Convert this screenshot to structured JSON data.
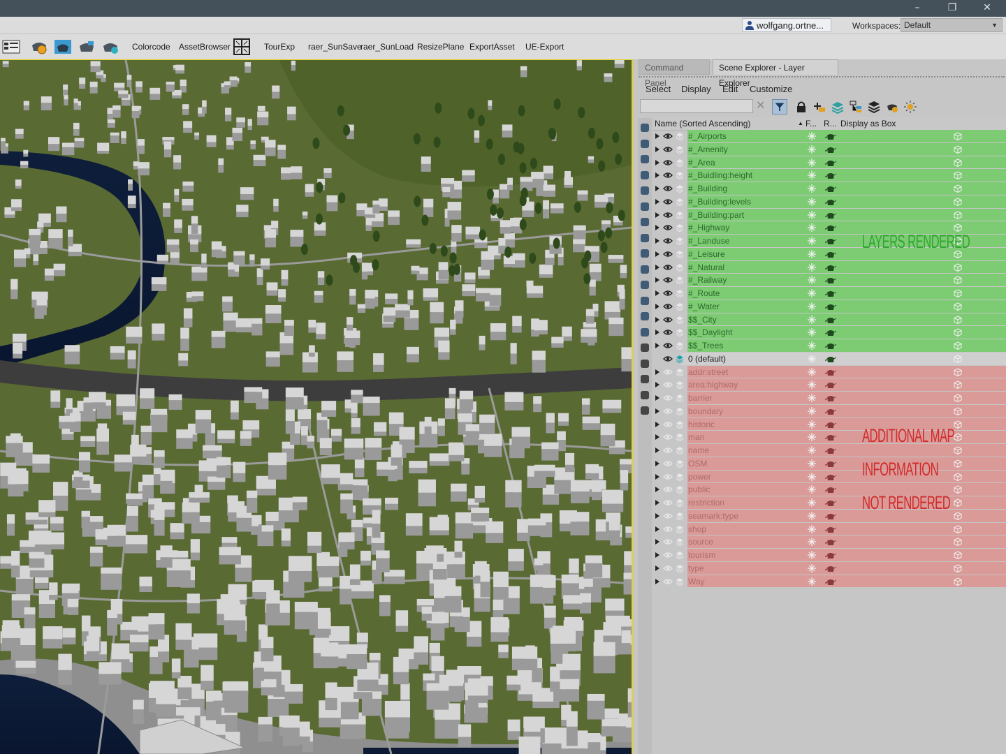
{
  "window": {
    "minimize": "–",
    "maximize": "❐",
    "close": "✕"
  },
  "user": {
    "name": "wolfgang.ortne...",
    "arrow": "▾"
  },
  "workspaces": {
    "label": "Workspaces:",
    "value": "Default"
  },
  "toolbar": {
    "items": [
      "Colorcode",
      "AssetBrowser",
      "TourExp",
      "raer_SunSave",
      "raer_SunLoad",
      "ResizePlane",
      "ExportAsset",
      "UE-Export"
    ]
  },
  "tabs": {
    "command_panel": "Command Panel",
    "scene_explorer": "Scene Explorer - Layer Explorer"
  },
  "scene_menu": {
    "select": "Select",
    "display": "Display",
    "edit": "Edit",
    "customize": "Customize"
  },
  "search": {
    "value": "",
    "clear": "✕"
  },
  "columns": {
    "name": "Name (Sorted Ascending)",
    "sort": "▲",
    "f": "F...",
    "r": "R...",
    "display": "Display as Box"
  },
  "layers": [
    {
      "name": "#_Airports",
      "state": "rendered"
    },
    {
      "name": "#_Amenity",
      "state": "rendered"
    },
    {
      "name": "#_Area",
      "state": "rendered"
    },
    {
      "name": "#_Buidling:height",
      "state": "rendered"
    },
    {
      "name": "#_Building",
      "state": "rendered"
    },
    {
      "name": "#_Building:levels",
      "state": "rendered"
    },
    {
      "name": "#_Building:part",
      "state": "rendered"
    },
    {
      "name": "#_Highway",
      "state": "rendered"
    },
    {
      "name": "#_Landuse",
      "state": "rendered"
    },
    {
      "name": "#_Leisure",
      "state": "rendered"
    },
    {
      "name": "#_Natural",
      "state": "rendered"
    },
    {
      "name": "#_Railway",
      "state": "rendered"
    },
    {
      "name": "#_Route",
      "state": "rendered"
    },
    {
      "name": "#_Water",
      "state": "rendered"
    },
    {
      "name": "$$_City",
      "state": "rendered"
    },
    {
      "name": "$$_Daylight",
      "state": "rendered"
    },
    {
      "name": "$$_Trees",
      "state": "rendered"
    },
    {
      "name": "0 (default)",
      "state": "default"
    },
    {
      "name": "addr:street",
      "state": "hidden"
    },
    {
      "name": "area:highway",
      "state": "hidden"
    },
    {
      "name": "barrier",
      "state": "hidden"
    },
    {
      "name": "boundary",
      "state": "hidden"
    },
    {
      "name": "historic",
      "state": "hidden"
    },
    {
      "name": "man",
      "state": "hidden"
    },
    {
      "name": "name",
      "state": "hidden"
    },
    {
      "name": "OSM",
      "state": "hidden"
    },
    {
      "name": "power",
      "state": "hidden"
    },
    {
      "name": "public",
      "state": "hidden"
    },
    {
      "name": "restriction",
      "state": "hidden"
    },
    {
      "name": "seamark:type",
      "state": "hidden"
    },
    {
      "name": "shop",
      "state": "hidden"
    },
    {
      "name": "source",
      "state": "hidden"
    },
    {
      "name": "tourism",
      "state": "hidden"
    },
    {
      "name": "type",
      "state": "hidden"
    },
    {
      "name": "Way",
      "state": "hidden"
    }
  ],
  "annotations": {
    "rendered": "LAYERS RENDERED",
    "not_rendered_1": "ADDITIONAL MAP",
    "not_rendered_2": "INFORMATION",
    "not_rendered_3": "NOT RENDERED"
  },
  "colors": {
    "rendered_row": "#7dcc74",
    "hidden_row": "#d99a98",
    "annotation_green": "#2fa52f",
    "annotation_red": "#d22a2a",
    "viewport_border": "#e8d020"
  }
}
